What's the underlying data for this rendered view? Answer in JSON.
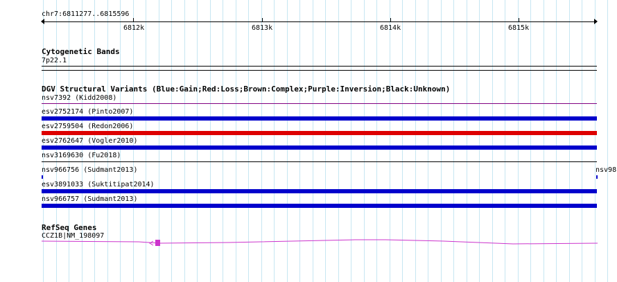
{
  "ruler": {
    "position_label": "chr7:6811277..6815596",
    "ticks": [
      {
        "label": "6812k"
      },
      {
        "label": "6813k"
      },
      {
        "label": "6814k"
      },
      {
        "label": "6815k"
      }
    ]
  },
  "cytoband": {
    "title": "Cytogenetic Bands",
    "band": "7p22.1"
  },
  "dgv": {
    "title": "DGV Structural Variants (Blue:Gain;Red:Loss;Brown:Complex;Purple:Inversion;Black:Unknown)",
    "variants": [
      {
        "label": "nsv7392 (Kidd2008)",
        "type": "Inversion",
        "color": "#800080"
      },
      {
        "label": "esv2752174 (Pinto2007)",
        "type": "Gain",
        "color": "#0000cc"
      },
      {
        "label": "esv2759504 (Redon2006)",
        "type": "Loss",
        "color": "#dd0000"
      },
      {
        "label": "esv2762647 (Vogler2010)",
        "type": "Gain",
        "color": "#0000cc"
      },
      {
        "label": "nsv3169630 (Fu2018)",
        "type": "Unknown",
        "color": "#000000"
      },
      {
        "label": "nsv966756 (Sudmant2013)",
        "right_label": "nsv98",
        "type": "Gain",
        "color": "#0000cc"
      },
      {
        "label": "esv3891033 (Suktitipat2014)",
        "type": "Gain",
        "color": "#0000cc"
      },
      {
        "label": "nsv966757 (Sudmant2013)",
        "type": "Gain",
        "color": "#0000cc"
      }
    ]
  },
  "refseq": {
    "title": "RefSeq Genes",
    "gene_label": "CCZ1B|NM_198097",
    "color": "#cc33cc"
  },
  "colors": {
    "grid": "#c6e6f2",
    "gain": "#0000cc",
    "loss": "#dd0000",
    "inversion": "#800080"
  }
}
